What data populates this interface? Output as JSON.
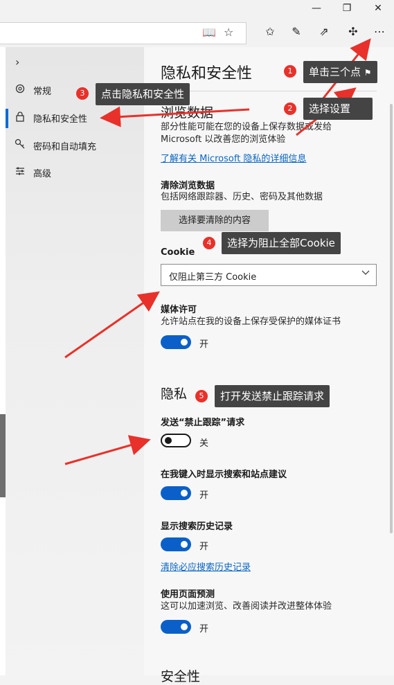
{
  "window": {
    "minimize": "—",
    "restore": "❐",
    "close": "✕"
  },
  "toolbar": {
    "reading_view_icon": "📖",
    "favorite_icon": "☆",
    "favorites_icon": "✩",
    "notes_icon": "✎",
    "share_icon": "⇗",
    "extensions_icon": "✣",
    "more_icon": "⋯"
  },
  "sidebar": {
    "expand_icon": "›",
    "items": [
      {
        "label": "常规",
        "icon": "gear-icon"
      },
      {
        "label": "隐私和安全性",
        "icon": "lock-icon"
      },
      {
        "label": "密码和自动填充",
        "icon": "key-icon"
      },
      {
        "label": "高级",
        "icon": "sliders-icon"
      }
    ]
  },
  "main": {
    "title": "隐私和安全性",
    "browsing_data": {
      "heading": "浏览数据",
      "desc_line1": "部分性能可能在您的设备上保存数据或发给",
      "desc_line2": "Microsoft 以改善您的浏览体验",
      "link": "了解有关 Microsoft 隐私的详细信息"
    },
    "clear_data": {
      "label": "清除浏览数据",
      "desc": "包括网络跟踪器、历史、密码及其他数据",
      "button": "选择要清除的内容"
    },
    "cookie": {
      "label": "Cookie",
      "selected": "仅阻止第三方 Cookie"
    },
    "media": {
      "label": "媒体许可",
      "desc": "允许站点在我的设备上保存受保护的媒体证书",
      "toggle_state": "开"
    },
    "privacy": {
      "heading": "隐私",
      "dnt": {
        "label": "发送“禁止跟踪”请求",
        "toggle_state": "关"
      },
      "suggestions": {
        "label": "在我键入时显示搜索和站点建议",
        "toggle_state": "开"
      },
      "history": {
        "label": "显示搜索历史记录",
        "toggle_state": "开",
        "link": "清除必应搜索历史记录"
      },
      "prediction": {
        "label": "使用页面预测",
        "desc": "这可以加速浏览、改善阅读并改进整体体验",
        "toggle_state": "开"
      }
    },
    "security": {
      "heading": "安全性"
    }
  },
  "annotations": [
    {
      "num": "1",
      "text": "单击三个点"
    },
    {
      "num": "2",
      "text": "选择设置"
    },
    {
      "num": "3",
      "text": "点击隐私和安全性"
    },
    {
      "num": "4",
      "text": "选择为阻止全部Cookie"
    },
    {
      "num": "5",
      "text": "打开发送禁止跟踪请求"
    }
  ],
  "colors": {
    "accent": "#0a60c8",
    "annotation_red": "#e8312a",
    "callout_bg": "#444444"
  }
}
